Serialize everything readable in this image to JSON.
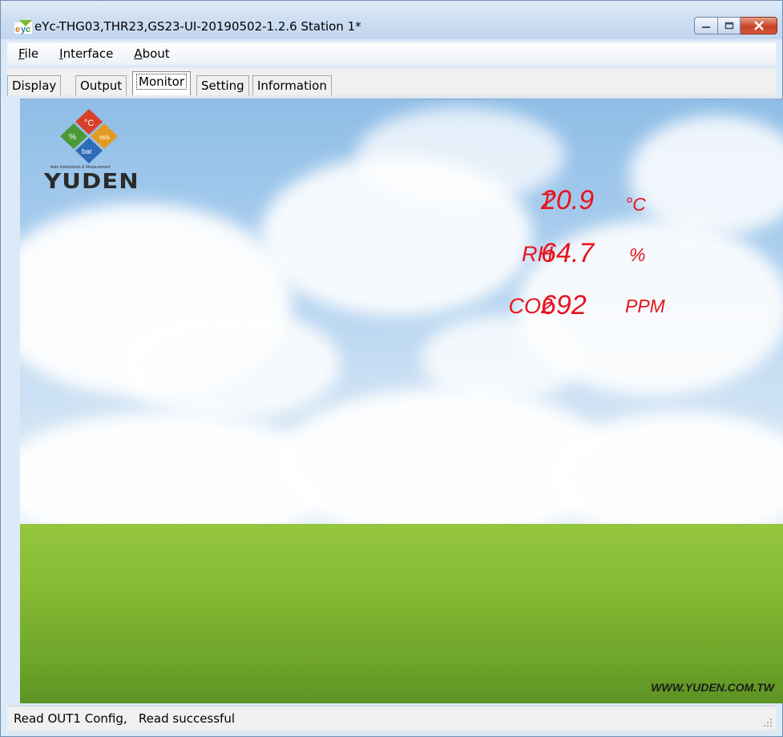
{
  "window": {
    "title": "eYc-THG03,THR23,GS23-UI-20190502-1.2.6  Station 1*",
    "icon": "app-icon"
  },
  "menu": [
    {
      "label": "File",
      "accel": "F",
      "rest": "ile"
    },
    {
      "label": "Interface",
      "accel": "I",
      "rest": "nterface"
    },
    {
      "label": "About",
      "accel": "A",
      "rest": "bout"
    }
  ],
  "tabs": [
    {
      "label": "Display"
    },
    {
      "label": "Output"
    },
    {
      "label": "Monitor",
      "active": true
    },
    {
      "label": "Setting"
    },
    {
      "label": "Information"
    }
  ],
  "logo": {
    "symbols": [
      "°C",
      "m/s",
      "%",
      "bar"
    ],
    "tagline": "Auto Instruments & Measurement",
    "name": "YUDEN"
  },
  "readings": [
    {
      "label": "T",
      "value": "20.9",
      "unit": "°C"
    },
    {
      "label": "RH",
      "value": "64.7",
      "unit": "%"
    },
    {
      "label": "CO2",
      "value": "692",
      "unit": "PPM"
    }
  ],
  "website": "WWW.YUDEN.COM.TW",
  "status": {
    "text": "Read OUT1 Config,   Read successful"
  },
  "colors": {
    "reading_red": "#e8141e",
    "sky": "#a9cdee",
    "grass": "#86bb34"
  }
}
